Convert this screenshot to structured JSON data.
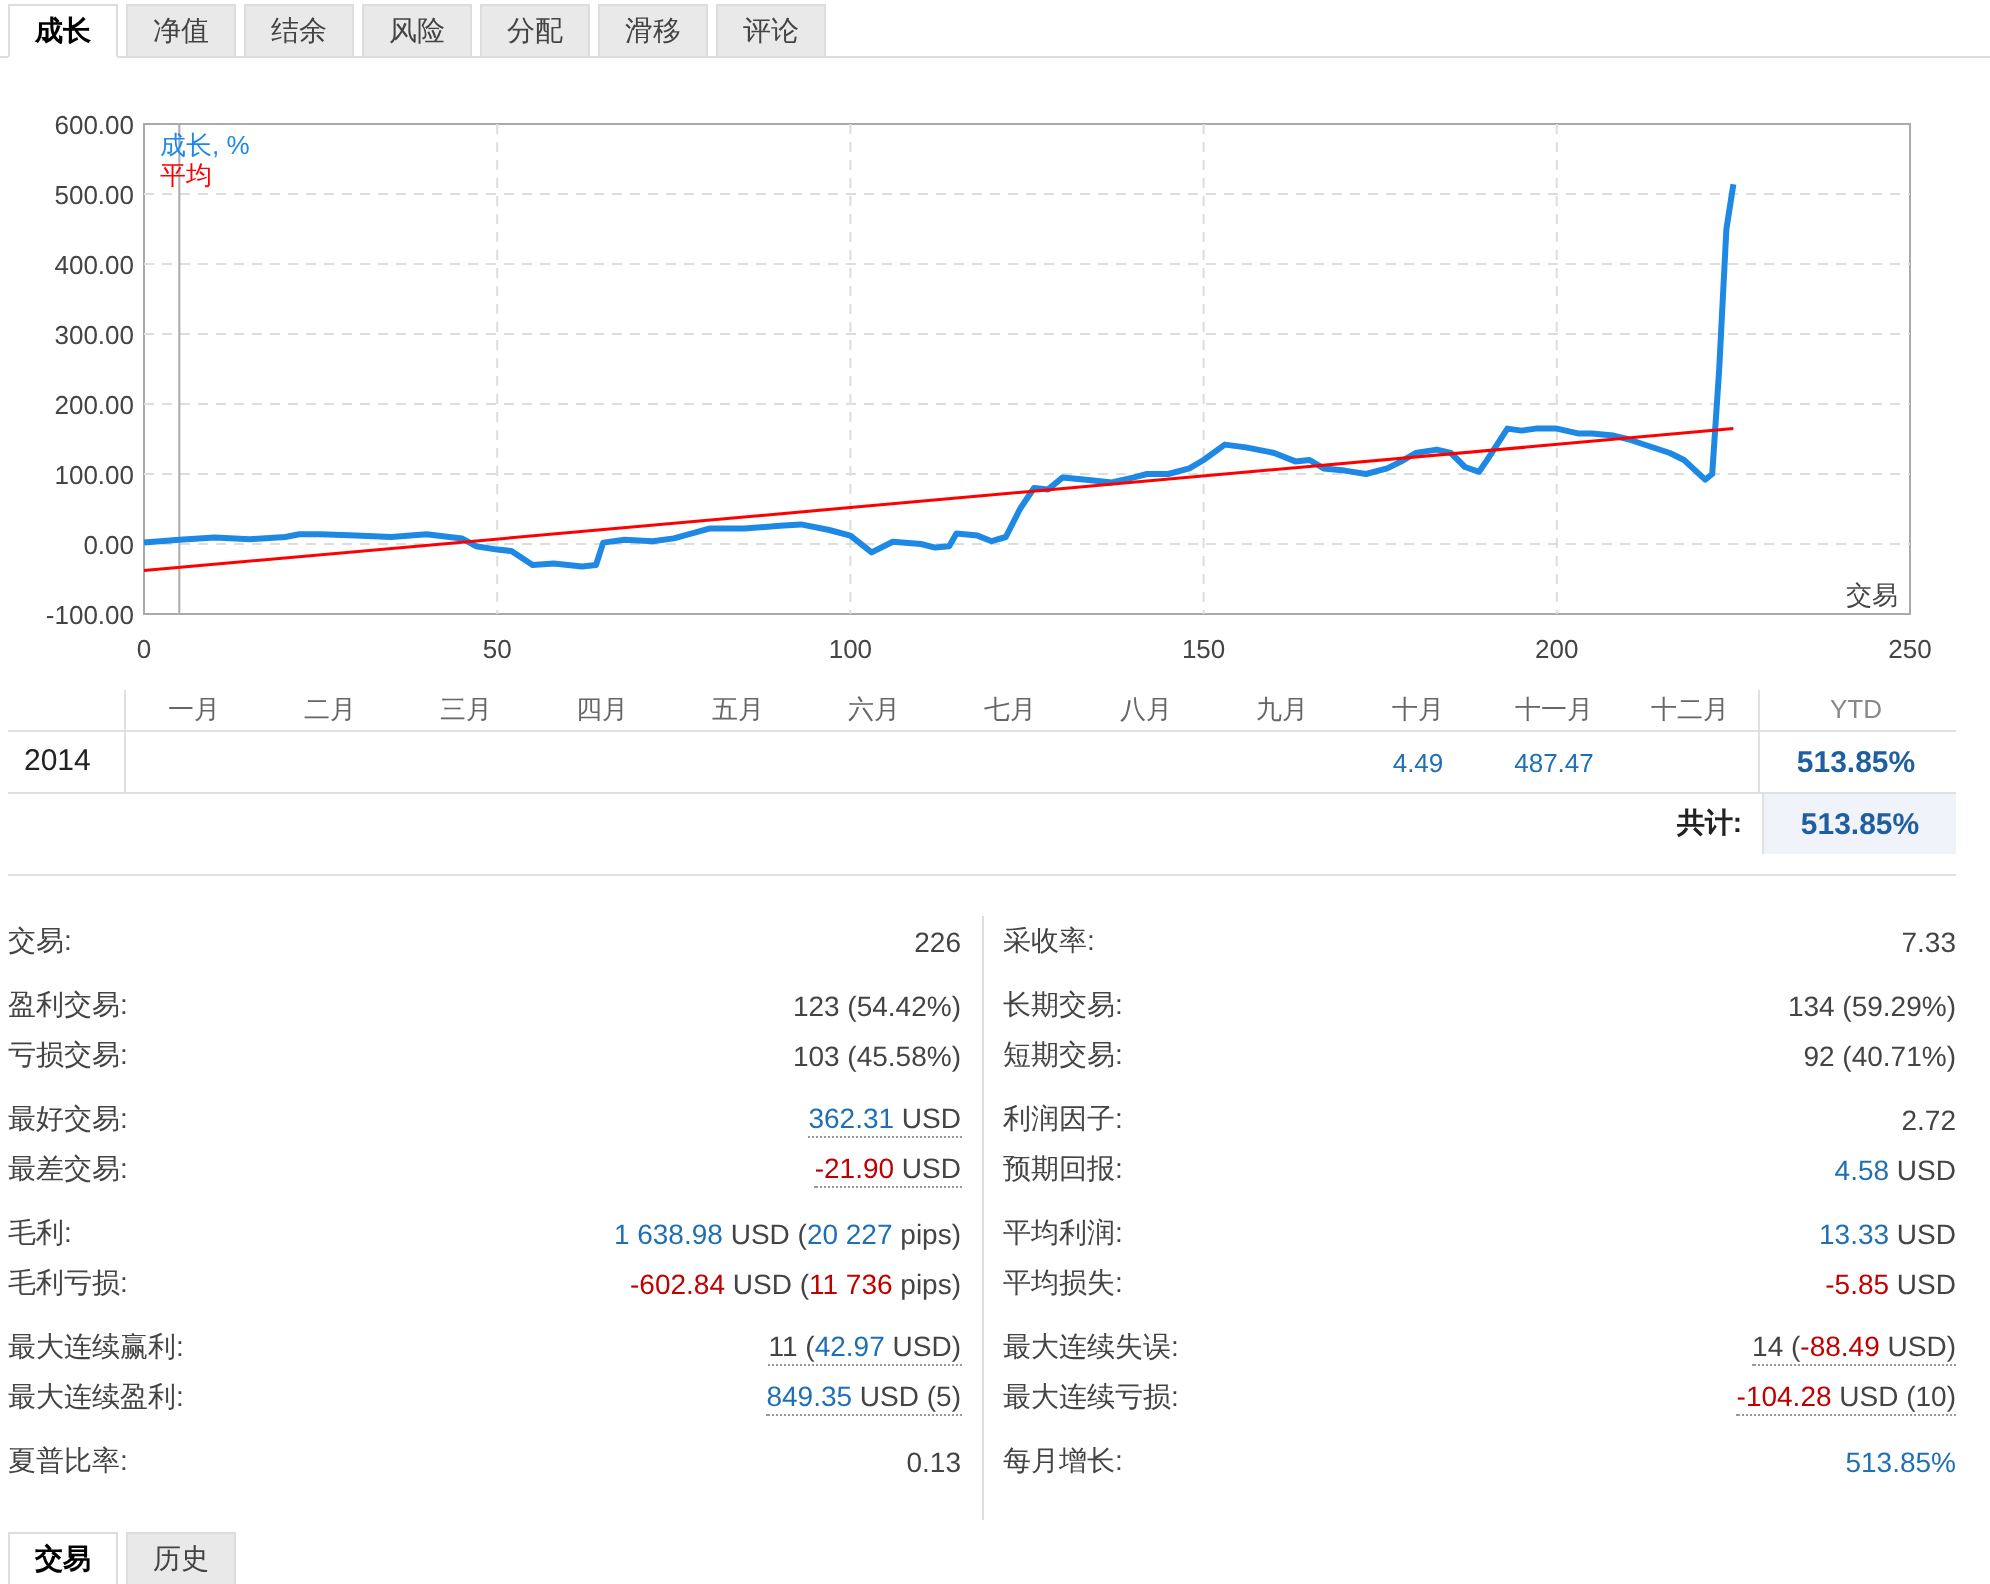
{
  "tabs": [
    {
      "label": "成长",
      "selected": true
    },
    {
      "label": "净值",
      "selected": false
    },
    {
      "label": "结余",
      "selected": false
    },
    {
      "label": "风险",
      "selected": false
    },
    {
      "label": "分配",
      "selected": false
    },
    {
      "label": "滑移",
      "selected": false
    },
    {
      "label": "评论",
      "selected": false
    }
  ],
  "chart_data": {
    "type": "line",
    "xlabel": "交易",
    "xlim": [
      0,
      250
    ],
    "ylim": [
      -100,
      600
    ],
    "xticks": [
      0,
      50,
      100,
      150,
      200,
      250
    ],
    "yticks": [
      {
        "value": -100,
        "label": "-100.00"
      },
      {
        "value": 0,
        "label": "0.00"
      },
      {
        "value": 100,
        "label": "100.00"
      },
      {
        "value": 200,
        "label": "200.00"
      },
      {
        "value": 300,
        "label": "300.00"
      },
      {
        "value": 400,
        "label": "400.00"
      },
      {
        "value": 500,
        "label": "500.00"
      },
      {
        "value": 600,
        "label": "600.00"
      }
    ],
    "x": [
      0,
      5,
      10,
      15,
      20,
      22,
      25,
      30,
      35,
      40,
      45,
      47,
      50,
      52,
      55,
      58,
      62,
      64,
      65,
      68,
      72,
      75,
      80,
      85,
      90,
      93,
      97,
      100,
      103,
      106,
      110,
      112,
      114,
      115,
      118,
      120,
      122,
      124,
      126,
      128,
      130,
      133,
      137,
      140,
      142,
      145,
      148,
      150,
      153,
      156,
      160,
      163,
      165,
      167,
      170,
      173,
      176,
      178,
      180,
      183,
      185,
      187,
      189,
      190,
      193,
      195,
      197,
      200,
      203,
      205,
      208,
      210,
      213,
      216,
      218,
      221,
      222,
      223,
      224,
      225
    ],
    "series": [
      {
        "name": "成长, %",
        "color": "#1e88e5",
        "values": [
          2,
          6,
          9,
          7,
          10,
          14,
          14,
          12,
          10,
          14,
          8,
          -3,
          -8,
          -10,
          -30,
          -28,
          -32,
          -30,
          2,
          6,
          4,
          8,
          22,
          22,
          26,
          28,
          20,
          12,
          -12,
          3,
          0,
          -5,
          -3,
          15,
          12,
          4,
          10,
          50,
          80,
          78,
          95,
          92,
          88,
          95,
          100,
          100,
          108,
          120,
          142,
          138,
          130,
          118,
          120,
          108,
          105,
          100,
          108,
          118,
          130,
          135,
          130,
          110,
          103,
          118,
          165,
          162,
          165,
          165,
          158,
          158,
          155,
          150,
          140,
          130,
          120,
          92,
          100,
          250,
          450,
          514
        ]
      },
      {
        "name": "平均",
        "color": "#ff0000",
        "values": [
          -38,
          null,
          null,
          null,
          null,
          null,
          null,
          null,
          null,
          null,
          null,
          null,
          null,
          null,
          null,
          null,
          null,
          null,
          null,
          null,
          null,
          null,
          null,
          null,
          null,
          null,
          null,
          null,
          null,
          null,
          null,
          null,
          null,
          null,
          null,
          null,
          null,
          null,
          null,
          null,
          null,
          null,
          null,
          null,
          null,
          null,
          null,
          null,
          null,
          null,
          null,
          null,
          null,
          null,
          null,
          null,
          null,
          null,
          null,
          null,
          null,
          null,
          null,
          null,
          null,
          null,
          null,
          null,
          null,
          null,
          null,
          null,
          null,
          null,
          null,
          null,
          null,
          null,
          null,
          165
        ]
      }
    ],
    "grid": true,
    "ref_lines": [
      {
        "axis": "x",
        "value": 5
      }
    ]
  },
  "monthly": {
    "columns": [
      "一月",
      "二月",
      "三月",
      "四月",
      "五月",
      "六月",
      "七月",
      "八月",
      "九月",
      "十月",
      "十一月",
      "十二月",
      "YTD"
    ],
    "rows": [
      {
        "year": "2014",
        "cells": [
          "",
          "",
          "",
          "",
          "",
          "",
          "",
          "",
          "",
          "4.49",
          "487.47",
          ""
        ],
        "ytd": "513.85%"
      }
    ],
    "total_label": "共计:",
    "total": "513.85%"
  },
  "stats": [
    [
      [
        {
          "label": "交易:",
          "parts": [
            {
              "text": "226",
              "kind": "plain"
            }
          ],
          "dotted": false
        }
      ],
      [
        {
          "label": "盈利交易:",
          "parts": [
            {
              "text": "123 (54.42%)",
              "kind": "plain"
            }
          ],
          "dotted": false
        },
        {
          "label": "亏损交易:",
          "parts": [
            {
              "text": "103 (45.58%)",
              "kind": "plain"
            }
          ],
          "dotted": false
        }
      ],
      [
        {
          "label": "最好交易:",
          "parts": [
            {
              "text": "362.31",
              "kind": "pos"
            },
            {
              "text": " USD",
              "kind": "plain"
            }
          ],
          "dotted": true
        },
        {
          "label": "最差交易:",
          "parts": [
            {
              "text": "-21.90",
              "kind": "neg"
            },
            {
              "text": " USD",
              "kind": "plain"
            }
          ],
          "dotted": true
        }
      ],
      [
        {
          "label": "毛利:",
          "parts": [
            {
              "text": "1 638.98",
              "kind": "pos"
            },
            {
              "text": " USD (",
              "kind": "plain"
            },
            {
              "text": "20 227",
              "kind": "pos"
            },
            {
              "text": " pips)",
              "kind": "plain"
            }
          ],
          "dotted": false
        },
        {
          "label": "毛利亏损:",
          "parts": [
            {
              "text": "-602.84",
              "kind": "neg"
            },
            {
              "text": " USD (",
              "kind": "plain"
            },
            {
              "text": "11 736",
              "kind": "neg"
            },
            {
              "text": " pips)",
              "kind": "plain"
            }
          ],
          "dotted": false
        }
      ],
      [
        {
          "label": "最大连续赢利:",
          "parts": [
            {
              "text": "11 (",
              "kind": "plain"
            },
            {
              "text": "42.97",
              "kind": "pos"
            },
            {
              "text": " USD)",
              "kind": "plain"
            }
          ],
          "dotted": true
        },
        {
          "label": "最大连续盈利:",
          "parts": [
            {
              "text": "849.35",
              "kind": "pos"
            },
            {
              "text": " USD (5)",
              "kind": "plain"
            }
          ],
          "dotted": true
        }
      ],
      [
        {
          "label": "夏普比率:",
          "parts": [
            {
              "text": "0.13",
              "kind": "plain"
            }
          ],
          "dotted": false
        }
      ]
    ],
    [
      [
        {
          "label": "采收率:",
          "parts": [
            {
              "text": "7.33",
              "kind": "plain"
            }
          ],
          "dotted": false
        }
      ],
      [
        {
          "label": "长期交易:",
          "parts": [
            {
              "text": "134 (59.29%)",
              "kind": "plain"
            }
          ],
          "dotted": false
        },
        {
          "label": "短期交易:",
          "parts": [
            {
              "text": "92 (40.71%)",
              "kind": "plain"
            }
          ],
          "dotted": false
        }
      ],
      [
        {
          "label": "利润因子:",
          "parts": [
            {
              "text": "2.72",
              "kind": "plain"
            }
          ],
          "dotted": false
        },
        {
          "label": "预期回报:",
          "parts": [
            {
              "text": "4.58",
              "kind": "pos"
            },
            {
              "text": " USD",
              "kind": "plain"
            }
          ],
          "dotted": false
        }
      ],
      [
        {
          "label": "平均利润:",
          "parts": [
            {
              "text": "13.33",
              "kind": "pos"
            },
            {
              "text": " USD",
              "kind": "plain"
            }
          ],
          "dotted": false
        },
        {
          "label": "平均损失:",
          "parts": [
            {
              "text": "-5.85",
              "kind": "neg"
            },
            {
              "text": " USD",
              "kind": "plain"
            }
          ],
          "dotted": false
        }
      ],
      [
        {
          "label": "最大连续失误:",
          "parts": [
            {
              "text": "14 (",
              "kind": "plain"
            },
            {
              "text": "-88.49",
              "kind": "neg"
            },
            {
              "text": " USD)",
              "kind": "plain"
            }
          ],
          "dotted": true
        },
        {
          "label": "最大连续亏损:",
          "parts": [
            {
              "text": "-104.28",
              "kind": "neg"
            },
            {
              "text": " USD (10)",
              "kind": "plain"
            }
          ],
          "dotted": true
        }
      ],
      [
        {
          "label": "每月增长:",
          "parts": [
            {
              "text": "513.85%",
              "kind": "pos"
            }
          ],
          "dotted": false
        }
      ]
    ]
  ],
  "bottom_tabs": [
    {
      "label": "交易",
      "selected": true
    },
    {
      "label": "历史",
      "selected": false
    }
  ]
}
